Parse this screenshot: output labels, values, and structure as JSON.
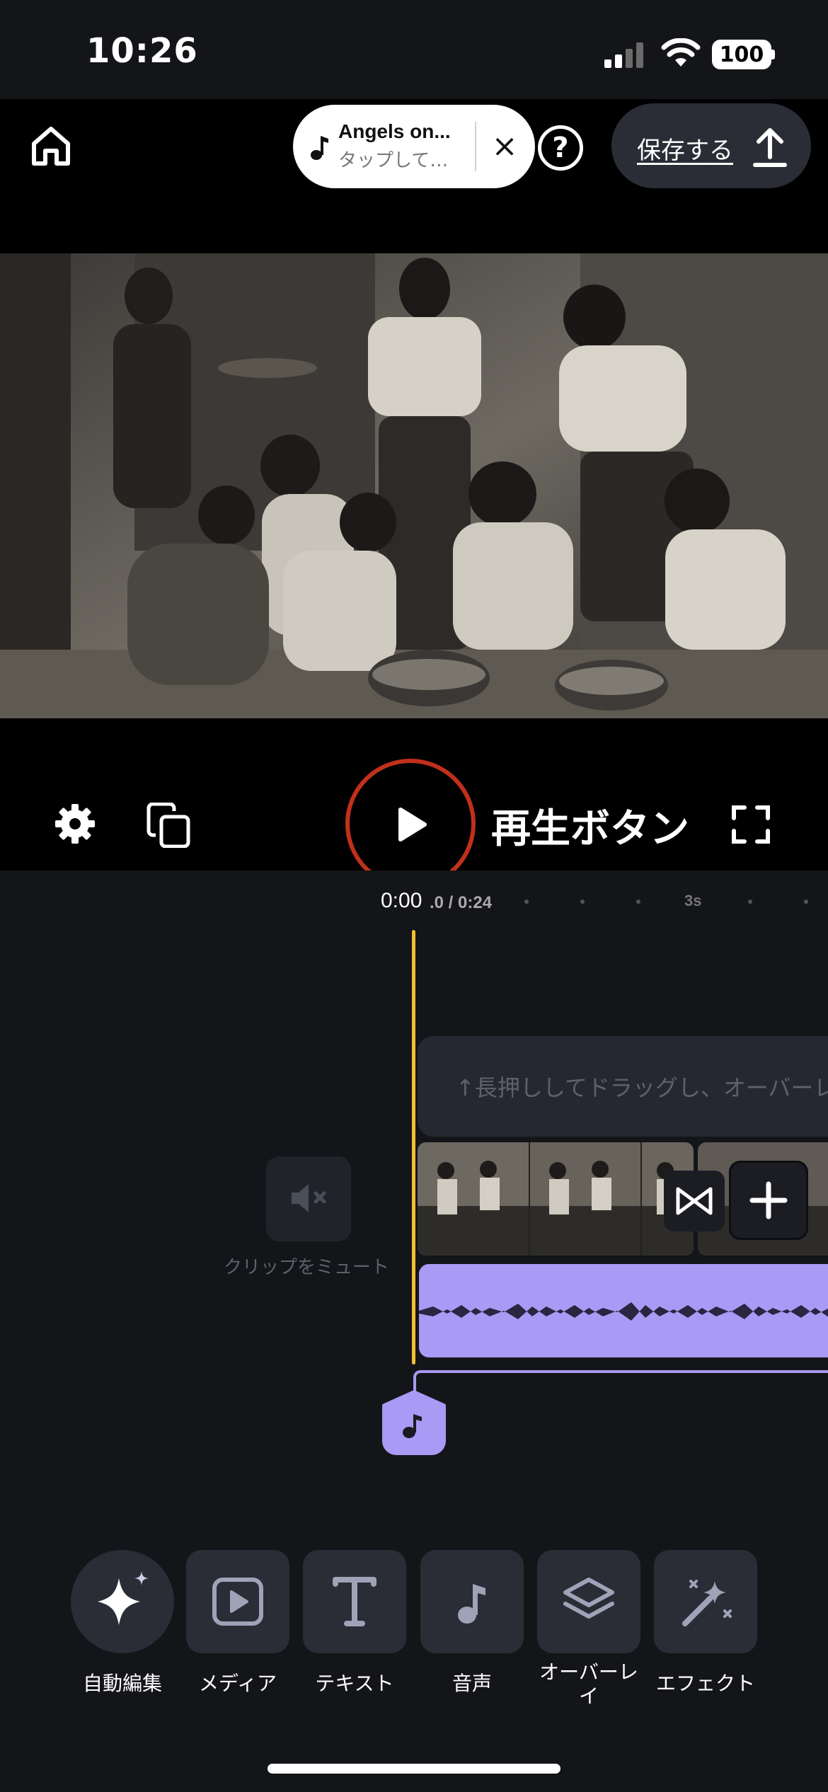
{
  "status_bar": {
    "time": "10:26",
    "battery": "100",
    "icons": [
      "signal-icon",
      "wifi-icon",
      "battery-icon"
    ]
  },
  "top_bar": {
    "home_icon": "home-icon",
    "music": {
      "title": "Angels on...",
      "subtitle": "タップして…",
      "close_label": "×"
    },
    "help_label": "?",
    "save_label": "保存する",
    "save_icon": "upload-icon"
  },
  "controls": {
    "play_caption": "再生ボタン",
    "icons": [
      "gear-icon",
      "copy-icon",
      "play-icon",
      "fullscreen-icon"
    ]
  },
  "timeline": {
    "current_time": "0:00",
    "current_time_sub": ".0 / 0:24",
    "tick_label": "3s",
    "overlay_hint": "↑長押ししてドラッグし、オーバーレ",
    "mute_label": "クリップをミュート",
    "accent_color": "#f2c230",
    "audio_color": "#a99af5"
  },
  "toolbar": {
    "items": [
      {
        "label": "自動編集",
        "icon": "sparkle-icon"
      },
      {
        "label": "メディア",
        "icon": "media-play-icon"
      },
      {
        "label": "テキスト",
        "icon": "text-icon"
      },
      {
        "label": "音声",
        "icon": "music-note-icon"
      },
      {
        "label": "オーバーレイ",
        "icon": "layers-icon"
      },
      {
        "label": "エフェクト",
        "icon": "magic-wand-icon"
      }
    ]
  }
}
